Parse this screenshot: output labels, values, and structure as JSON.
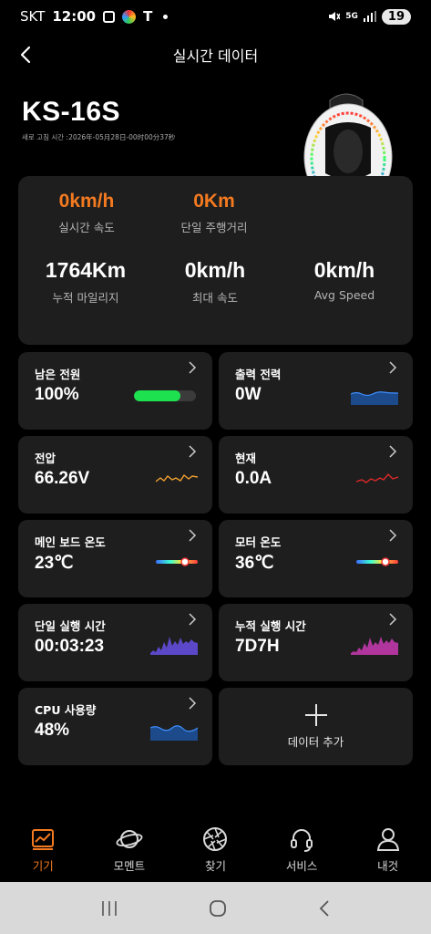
{
  "status_bar": {
    "carrier": "SKT",
    "time": "12:00",
    "net": "5G",
    "battery": "19"
  },
  "header": {
    "title": "실시간 데이터"
  },
  "device": {
    "name": "KS-16S",
    "refresh_time": "새로 고침 시간 :2026年-05月28日-00时00分37秒"
  },
  "stats": {
    "speed": {
      "value": "0km/h",
      "label": "실시간 속도"
    },
    "trip": {
      "value": "0Km",
      "label": "단일 주행거리"
    },
    "total_mileage": {
      "value": "1764Km",
      "label": "누적 마일리지"
    },
    "max_speed": {
      "value": "0km/h",
      "label": "최대 속도"
    },
    "avg_speed": {
      "value": "0km/h",
      "label": "Avg Speed"
    }
  },
  "tiles": {
    "battery": {
      "label": "남은 전원",
      "value": "100%",
      "level": 0.75
    },
    "power": {
      "label": "출력 전력",
      "value": "0W"
    },
    "voltage": {
      "label": "전압",
      "value": "66.26V"
    },
    "current": {
      "label": "현재",
      "value": "0.0A"
    },
    "board_temp": {
      "label": "메인 보드 온도",
      "value": "23℃"
    },
    "motor_temp": {
      "label": "모터 온도",
      "value": "36℃"
    },
    "trip_time": {
      "label": "단일 실행 시간",
      "value": "00:03:23"
    },
    "total_time": {
      "label": "누적 실행 시간",
      "value": "7D7H"
    },
    "cpu": {
      "label": "CPU 사용량",
      "value": "48%"
    },
    "add": {
      "label": "데이터 추가"
    }
  },
  "nav": [
    {
      "label": "기기",
      "icon": "device-icon"
    },
    {
      "label": "모멘트",
      "icon": "planet-icon"
    },
    {
      "label": "찾기",
      "icon": "aperture-icon"
    },
    {
      "label": "서비스",
      "icon": "headset-icon"
    },
    {
      "label": "내것",
      "icon": "person-icon"
    }
  ],
  "colors": {
    "accent": "#f47a20",
    "card": "#1e1e1e",
    "battery_fill": "#1ee14f"
  }
}
